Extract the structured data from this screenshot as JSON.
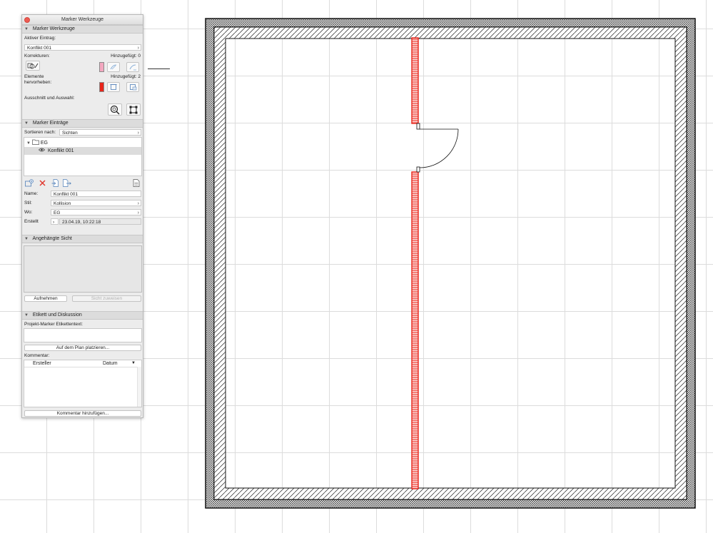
{
  "palette": {
    "title": "Marker Werkzeuge",
    "section_tools": {
      "header": "Marker Werkzeuge",
      "active_entry_label": "Aktiver Eintrag:",
      "active_entry_value": "Konflikt 001",
      "corrections_label": "Korrekturen:",
      "corrections_added": "Hinzugefügt: 0",
      "corrections_color": "#f3a7bf",
      "highlight_label_1": "Elemente",
      "highlight_label_2": "hervorheben:",
      "highlight_added": "Hinzugefügt: 2",
      "highlight_color": "#e8251b",
      "cutout_label": "Ausschnitt und Auswahl:"
    },
    "section_entries": {
      "header": "Marker Einträge",
      "sort_label": "Sortieren nach:",
      "sort_value": "Sichten",
      "tree": {
        "folder": "EG",
        "item": "Konflikt 001"
      },
      "name_label": "Name:",
      "name_value": "Konflikt 001",
      "style_label": "Stil:",
      "style_value": "Kollision",
      "where_label": "Wo:",
      "where_value": "EG",
      "created_label": "Erstellt",
      "created_value": "23.04.19, 10:22:18"
    },
    "section_view": {
      "header": "Angehängte Sicht",
      "capture_button": "Aufnehmen",
      "assign_button": "Sicht zuweisen"
    },
    "section_discussion": {
      "header": "Etikett und Diskussion",
      "label_text_label": "Projekt-Marker Etikettentext:",
      "place_button": "Auf dem Plan platzieren...",
      "comments_label": "Kommentar:",
      "col_author": "Ersteller",
      "col_date": "Datum",
      "add_comment_button": "Kommentar hinzufügen..."
    }
  },
  "colors": {
    "highlight_red": "#e8251b",
    "wall_outline": "#111111"
  }
}
